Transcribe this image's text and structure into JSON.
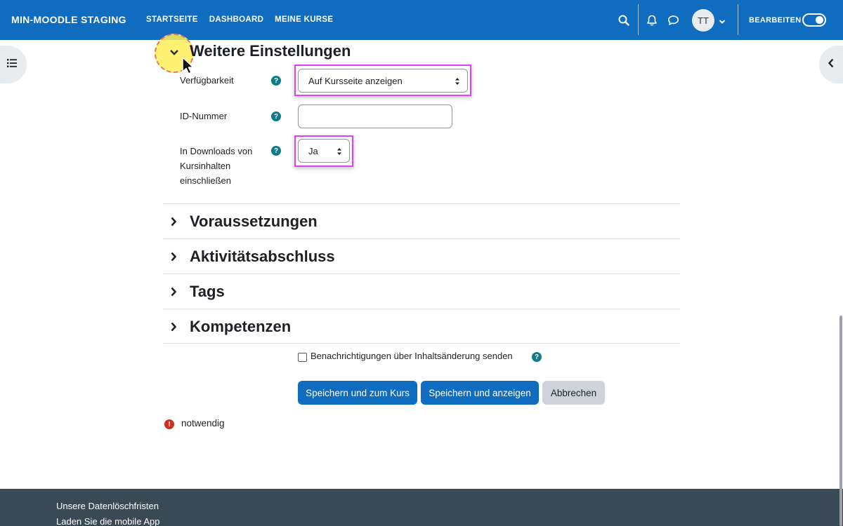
{
  "navbar": {
    "brand": "MIN-MOODLE STAGING",
    "links": [
      "STARTSEITE",
      "DASHBOARD",
      "MEINE KURSE"
    ],
    "avatar_initials": "TT",
    "edit_label": "BEARBEITEN",
    "edit_mode_on": true,
    "color": "#0f6cbf"
  },
  "section": {
    "title": "Weitere Einstellungen"
  },
  "form": {
    "availability": {
      "label": "Verfügbarkeit",
      "value": "Auf Kursseite anzeigen"
    },
    "id_number": {
      "label": "ID-Nummer",
      "value": ""
    },
    "downloads": {
      "label_line1": "In Downloads von",
      "label_line2": "Kursinhalten",
      "label_line3": "einschließen",
      "value": "Ja"
    }
  },
  "collapsed_sections": [
    {
      "title": "Voraussetzungen"
    },
    {
      "title": "Aktivitätsabschluss"
    },
    {
      "title": "Tags"
    },
    {
      "title": "Kompetenzen"
    }
  ],
  "notify": {
    "label": "Benachrichtigungen über Inhaltsänderung senden",
    "checked": false
  },
  "buttons": {
    "save_return": "Speichern und zum Kurs",
    "save_display": "Speichern und anzeigen",
    "cancel": "Abbrechen"
  },
  "required_note": "notwendig",
  "footer": {
    "links": [
      "Unsere Datenlöschfristen",
      "Laden Sie die mobile App"
    ]
  },
  "colors": {
    "primary": "#0f6cbf",
    "help": "#0f7a88",
    "required": "#ca3120",
    "highlight": "#e040fb",
    "footer": "#3a4a55"
  }
}
